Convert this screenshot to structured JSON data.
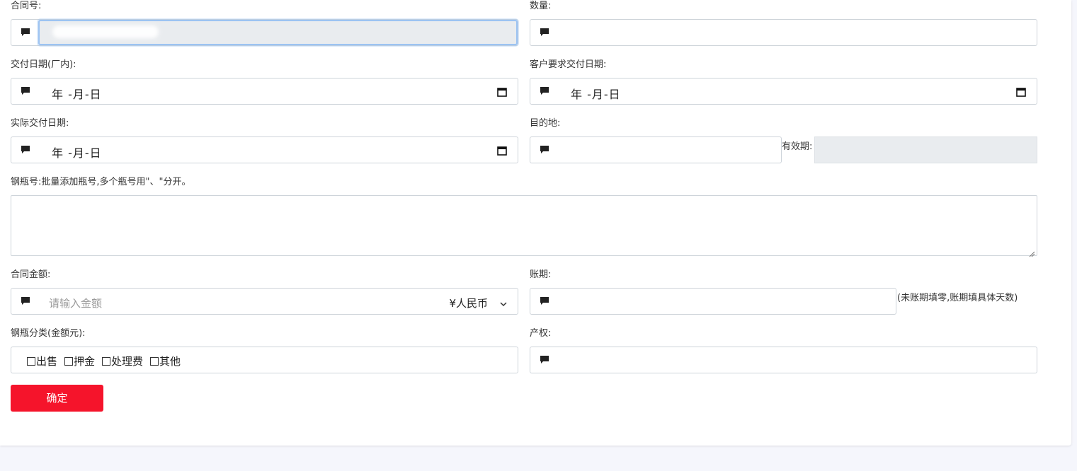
{
  "form": {
    "contract_no_label": "合同号:",
    "quantity_label": "数量:",
    "delivery_factory_label": "交付日期(厂内):",
    "delivery_customer_label": "客户要求交付日期:",
    "actual_delivery_label": "实际交付日期:",
    "destination_label": "目的地:",
    "validity_label": "有效期:",
    "cylinder_no_label": "钢瓶号:批量添加瓶号,多个瓶号用\"、\"分开。",
    "amount_label": "合同金额:",
    "amount_placeholder": "请输入金额",
    "currency_value": "¥人民币",
    "account_period_label": "账期:",
    "account_period_note": "(未账期填零,账期填具体天数)",
    "cylinder_category_label": "钢瓶分类(金额元):",
    "cylinder_categories": [
      "出售",
      "押金",
      "处理费",
      "其他"
    ],
    "property_label": "产权:",
    "date_placeholder": "年 -月-日",
    "submit_label": "确定"
  },
  "icons": {
    "field_icon": "comment-icon",
    "date_icon": "calendar-icon",
    "select_icon": "chevron-down-icon"
  },
  "colors": {
    "accent_button": "#f5142b",
    "readonly_bg": "#e9ecef",
    "focus_border": "#9cc3f2"
  }
}
